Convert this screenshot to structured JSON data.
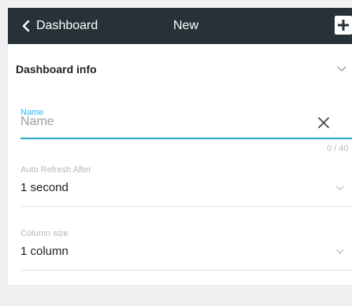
{
  "header": {
    "back_label": "Dashboard",
    "title": "New",
    "add_icon": "plus-icon",
    "background": "#263238"
  },
  "section": {
    "title": "Dashboard info",
    "chevron_icon": "chevron-down-icon"
  },
  "name_field": {
    "label": "Name",
    "placeholder": "Name",
    "value": "",
    "counter": "0 / 40",
    "clear_icon": "close-icon",
    "accent": "#29b6f6"
  },
  "auto_refresh": {
    "label": "Auto Refresh After",
    "value": "1 second",
    "chevron_icon": "chevron-down-icon"
  },
  "column_size": {
    "label": "Column size",
    "value": "1 column",
    "chevron_icon": "chevron-down-icon"
  }
}
